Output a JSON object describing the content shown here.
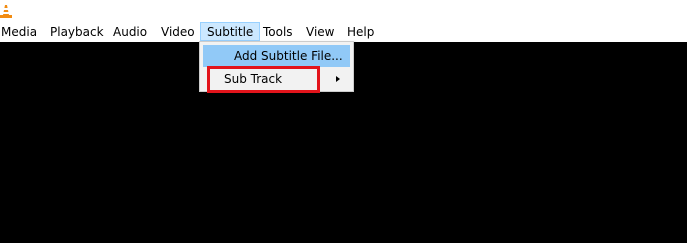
{
  "menubar": {
    "items": [
      {
        "label": "Media"
      },
      {
        "label": "Playback"
      },
      {
        "label": "Audio"
      },
      {
        "label": "Video"
      },
      {
        "label": "Subtitle"
      },
      {
        "label": "Tools"
      },
      {
        "label": "View"
      },
      {
        "label": "Help"
      }
    ],
    "active_item": "Subtitle"
  },
  "subtitle_menu": {
    "items": [
      {
        "label": "Add Subtitle File...",
        "highlighted": true,
        "has_submenu": false
      },
      {
        "label": "Sub Track",
        "highlighted": false,
        "has_submenu": true
      }
    ]
  },
  "icons": {
    "logo": "vlc-cone-icon",
    "submenu": "chevron-right-icon"
  },
  "colors": {
    "menubar_bg": "#ffffff",
    "video_area_bg": "#000000",
    "active_menu_bg": "#cce8ff",
    "active_menu_border": "#99d1ff",
    "dropdown_bg": "#f2f2f2",
    "highlight_bg": "#91c9f7",
    "annotation_border": "#e3141b",
    "logo_orange": "#f28c12"
  }
}
